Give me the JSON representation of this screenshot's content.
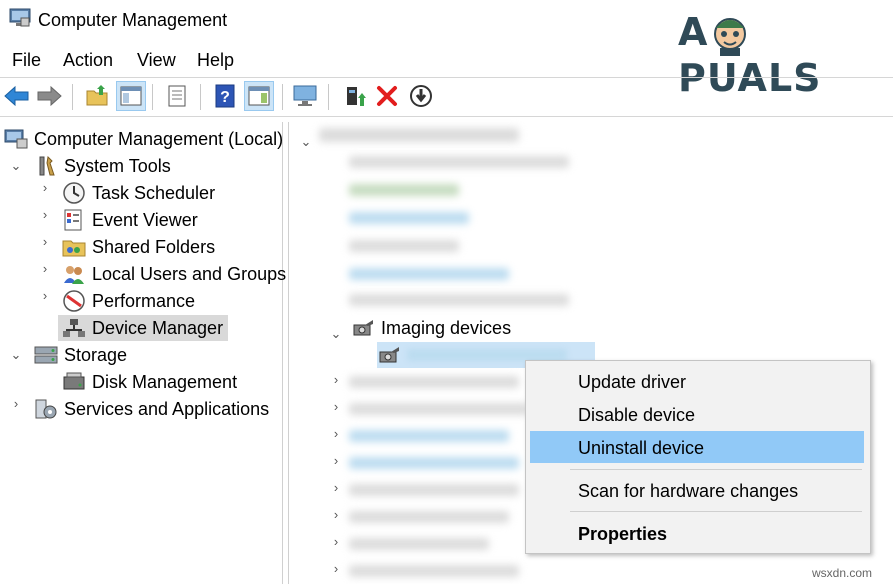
{
  "window": {
    "title": "Computer Management"
  },
  "logo": {
    "left": "A",
    "right": "PUALS"
  },
  "menu": [
    "File",
    "Action",
    "View",
    "Help"
  ],
  "toolbar_icons": [
    "back-arrow-icon",
    "forward-arrow-icon",
    "up-folder-icon",
    "show-hide-console-tree-icon",
    "export-list-icon",
    "help-icon",
    "show-hide-action-pane-icon",
    "computer-monitor-icon",
    "update-driver-icon",
    "uninstall-x-icon",
    "download-icon"
  ],
  "left_tree": {
    "root": "Computer Management (Local)",
    "system_tools": "System Tools",
    "task_scheduler": "Task Scheduler",
    "event_viewer": "Event Viewer",
    "shared_folders": "Shared Folders",
    "local_users": "Local Users and Groups",
    "performance": "Performance",
    "device_manager": "Device Manager",
    "storage": "Storage",
    "disk_management": "Disk Management",
    "services": "Services and Applications"
  },
  "right_tree": {
    "imaging_devices": "Imaging devices"
  },
  "context_menu": {
    "update_driver": "Update driver",
    "disable_device": "Disable device",
    "uninstall_device": "Uninstall device",
    "scan_hardware": "Scan for hardware changes",
    "properties": "Properties"
  },
  "watermark": "wsxdn.com"
}
